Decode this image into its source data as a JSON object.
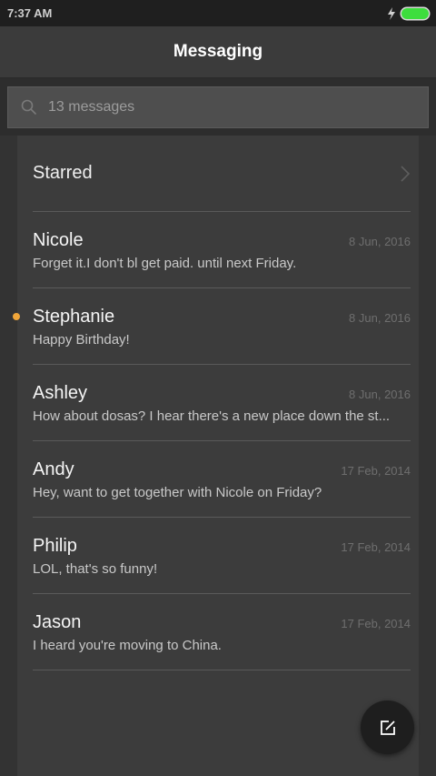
{
  "status": {
    "time": "7:37 AM"
  },
  "header": {
    "title": "Messaging"
  },
  "search": {
    "placeholder": "13 messages"
  },
  "starred": {
    "label": "Starred"
  },
  "conversations": [
    {
      "name": "Nicole",
      "date": "8 Jun, 2016",
      "preview": "Forget it.I don't bl get paid. until next Friday."
    },
    {
      "name": "Stephanie",
      "date": "8 Jun, 2016",
      "preview": "Happy Birthday!",
      "unread": true
    },
    {
      "name": "Ashley",
      "date": "8 Jun, 2016",
      "preview": "How about dosas? I hear there's a new place down the st..."
    },
    {
      "name": "Andy",
      "date": "17 Feb, 2014",
      "preview": "Hey, want to get together with Nicole on Friday?"
    },
    {
      "name": "Philip",
      "date": "17 Feb, 2014",
      "preview": "LOL, that's so funny!"
    },
    {
      "name": "Jason",
      "date": "17 Feb, 2014",
      "preview": "I heard you're moving to China."
    }
  ],
  "colors": {
    "unread_dot": "#f0a63a",
    "battery": "#3dde3d"
  },
  "icons": {
    "compose": "compose-icon",
    "search": "search-icon",
    "chevron": "chevron-right-icon"
  }
}
